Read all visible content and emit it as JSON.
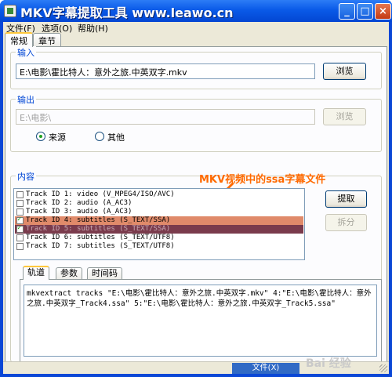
{
  "window": {
    "title": "MKV字幕提取工具  www.leawo.cn",
    "buttons": {
      "minimize": "_",
      "maximize": "□",
      "close": "×"
    }
  },
  "menu": {
    "items": [
      {
        "label": "文件(F)"
      },
      {
        "label": "选项(O)"
      },
      {
        "label": "帮助(H)"
      }
    ]
  },
  "tabs": [
    {
      "label": "常规",
      "active": true
    },
    {
      "label": "章节",
      "active": false
    }
  ],
  "input_group": {
    "label": "输入",
    "path_value": "E:\\电影\\霍比特人：意外之旅.中英双字.mkv",
    "browse_label": "浏览"
  },
  "output_group": {
    "label": "输出",
    "path_value": "E:\\电影\\",
    "browse_label": "浏览",
    "radio_source": "来源",
    "radio_other": "其他",
    "selected": "source"
  },
  "content_group": {
    "label": "内容",
    "tracks": [
      {
        "text": "Track ID 1: video (V_MPEG4/ISO/AVC)",
        "checked": false,
        "highlight": ""
      },
      {
        "text": "Track ID 2: audio (A_AC3)",
        "checked": false,
        "highlight": ""
      },
      {
        "text": "Track ID 3: audio (A_AC3)",
        "checked": false,
        "highlight": ""
      },
      {
        "text": "Track ID 4: subtitles (S_TEXT/SSA)",
        "checked": true,
        "highlight": "hl1"
      },
      {
        "text": "Track ID 5: subtitles (S_TEXT/SSA)",
        "checked": true,
        "highlight": "hl2"
      },
      {
        "text": "Track ID 6: subtitles (S_TEXT/UTF8)",
        "checked": false,
        "highlight": ""
      },
      {
        "text": "Track ID 7: subtitles (S_TEXT/UTF8)",
        "checked": false,
        "highlight": ""
      }
    ],
    "extract_label": "提取",
    "split_label": "拆分",
    "annotation": "MKV视频中的ssa字幕文件",
    "annotation_color": "#ff6a00"
  },
  "subtabs": [
    {
      "label": "轨道",
      "active": true
    },
    {
      "label": "参数",
      "active": false
    },
    {
      "label": "时间码",
      "active": false
    }
  ],
  "command": "mkvextract tracks \"E:\\电影\\霍比特人：意外之旅.中英双字.mkv\" 4:\"E:\\电影\\霍比特人：意外之旅.中英双字_Track4.ssa\" 5:\"E:\\电影\\霍比特人：意外之旅.中英双字_Track5.ssa\"",
  "statusbar": {
    "pane_label": "文件(X)"
  },
  "watermark": "Bai 经验"
}
